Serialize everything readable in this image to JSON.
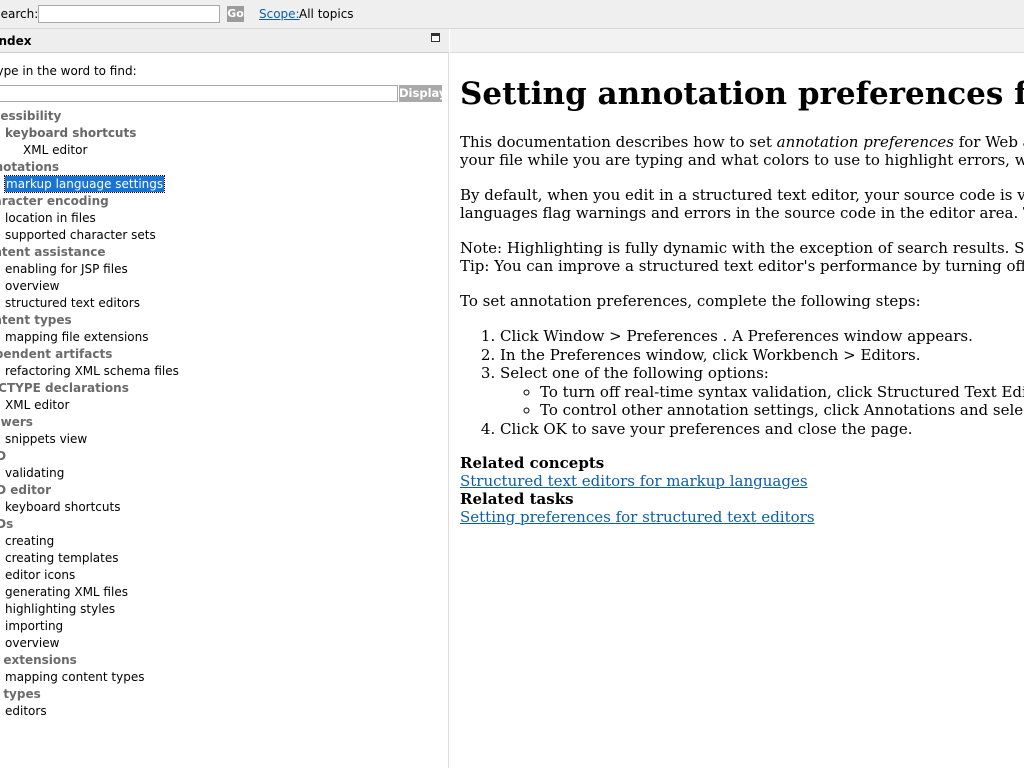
{
  "topbar": {
    "search_label": "Search:",
    "search_value": "",
    "go_label": "Go",
    "scope_label": "Scope:",
    "scope_value": "All topics"
  },
  "index_pane": {
    "title": "Index",
    "prompt": "Type in the word to find:",
    "input_value": "",
    "display_label": "Display",
    "items": [
      {
        "label": "accessibility",
        "level": 0
      },
      {
        "label": "keyboard shortcuts",
        "level": 1,
        "bold": true
      },
      {
        "label": "XML editor",
        "level": 2
      },
      {
        "label": "annotations",
        "level": 0
      },
      {
        "label": "markup language settings",
        "level": 1,
        "selected": true
      },
      {
        "label": "character encoding",
        "level": 0
      },
      {
        "label": "location in files",
        "level": 1
      },
      {
        "label": "supported character sets",
        "level": 1
      },
      {
        "label": "content assistance",
        "level": 0
      },
      {
        "label": "enabling for JSP files",
        "level": 1
      },
      {
        "label": "overview",
        "level": 1
      },
      {
        "label": "structured text editors",
        "level": 1
      },
      {
        "label": "content types",
        "level": 0
      },
      {
        "label": "mapping file extensions",
        "level": 1
      },
      {
        "label": "dependent artifacts",
        "level": 0
      },
      {
        "label": "refactoring XML schema files",
        "level": 1
      },
      {
        "label": "DOCTYPE declarations",
        "level": 0
      },
      {
        "label": "XML editor",
        "level": 1
      },
      {
        "label": "drawers",
        "level": 0
      },
      {
        "label": "snippets view",
        "level": 1
      },
      {
        "label": "DTD",
        "level": 0
      },
      {
        "label": "validating",
        "level": 1
      },
      {
        "label": "DTD editor",
        "level": 0
      },
      {
        "label": "keyboard shortcuts",
        "level": 1
      },
      {
        "label": "DTDs",
        "level": 0
      },
      {
        "label": "creating",
        "level": 1
      },
      {
        "label": "creating templates",
        "level": 1
      },
      {
        "label": "editor icons",
        "level": 1
      },
      {
        "label": "generating XML files",
        "level": 1
      },
      {
        "label": "highlighting styles",
        "level": 1
      },
      {
        "label": "importing",
        "level": 1
      },
      {
        "label": "overview",
        "level": 1
      },
      {
        "label": "file extensions",
        "level": 0
      },
      {
        "label": "mapping content types",
        "level": 1
      },
      {
        "label": "file types",
        "level": 0
      },
      {
        "label": "editors",
        "level": 1
      }
    ]
  },
  "content": {
    "title": "Setting annotation preferences for markup languages",
    "p1_before": "This documentation describes how to set ",
    "p1_em": "annotation preferences",
    "p1_after": " for Web and XML files. The annotation preferences include whether to analyze the syntax, validate",
    "p1_line2": "your file while you are typing and what colors to use to highlight errors, warnings, tasks, search results, bookmarks, and other text.",
    "p2_line1": "By default, when you edit in a structured text editor, your source code is validated as you type it in. Like other Eclipse editors, the",
    "p2_line2": "languages flag warnings and errors in the source code in the editor area. The warnings and errors also appear in the Problems view.",
    "note": "Note: Highlighting is fully dynamic with the exception of search results. Search results appear highlighted after you run a search.",
    "tip": "Tip: You can improve a structured text editor's performance by turning off the real-time syntax validation.",
    "steps_intro": "To set annotation preferences, complete the following steps:",
    "steps": [
      "Click Window > Preferences . A Preferences window appears.",
      "In the Preferences window, click Workbench > Editors.",
      "Select one of the following options:",
      "Click OK to save your preferences and close the page."
    ],
    "substeps": [
      "To turn off real-time syntax validation, click Structured Text Editor and uncheck Analyze annotations while typing.",
      "To control other annotation settings, click Annotations and select your annotation preferences."
    ],
    "related_concepts_label": "Related concepts",
    "related_concepts_link": "Structured text editors for markup languages",
    "related_tasks_label": "Related tasks",
    "related_tasks_link": "Setting preferences for structured text editors"
  }
}
